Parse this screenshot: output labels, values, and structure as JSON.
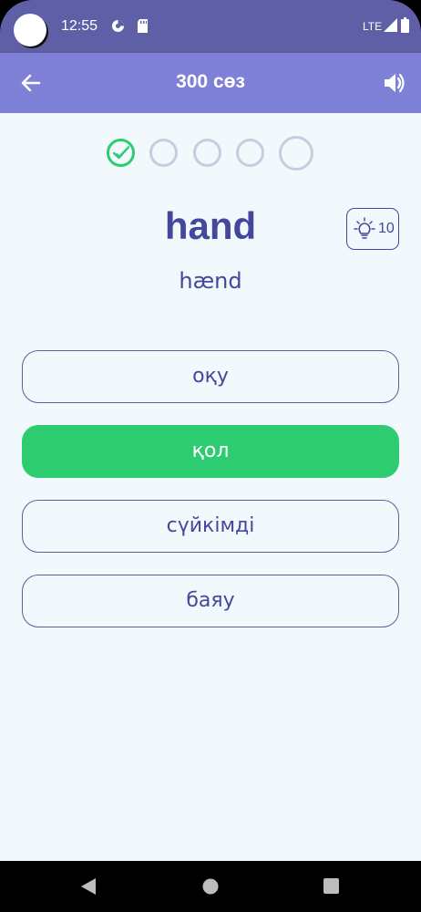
{
  "status_bar": {
    "time": "12:55",
    "network": "LTE",
    "icons": [
      "camera-cutout",
      "data-saver-icon",
      "sd-card-icon",
      "signal-icon",
      "battery-icon"
    ]
  },
  "app_bar": {
    "title": "300 сөз",
    "back_icon": "arrow-left-icon",
    "sound_icon": "speaker-icon"
  },
  "progress": {
    "total": 5,
    "completed": 1,
    "current": 5
  },
  "question": {
    "word": "hand",
    "transcription": "hænd"
  },
  "hint": {
    "icon": "lightbulb-icon",
    "count": "10"
  },
  "options": [
    {
      "label": "оқу",
      "state": "default"
    },
    {
      "label": "қол",
      "state": "correct"
    },
    {
      "label": "сүйкімді",
      "state": "default"
    },
    {
      "label": "баяу",
      "state": "default"
    }
  ],
  "colors": {
    "status_bar": "#5e5fa6",
    "app_bar": "#7f80d8",
    "background": "#f2f9fd",
    "accent_text": "#43489b",
    "correct": "#2ecc71",
    "inactive_dot": "#c8cce0"
  }
}
